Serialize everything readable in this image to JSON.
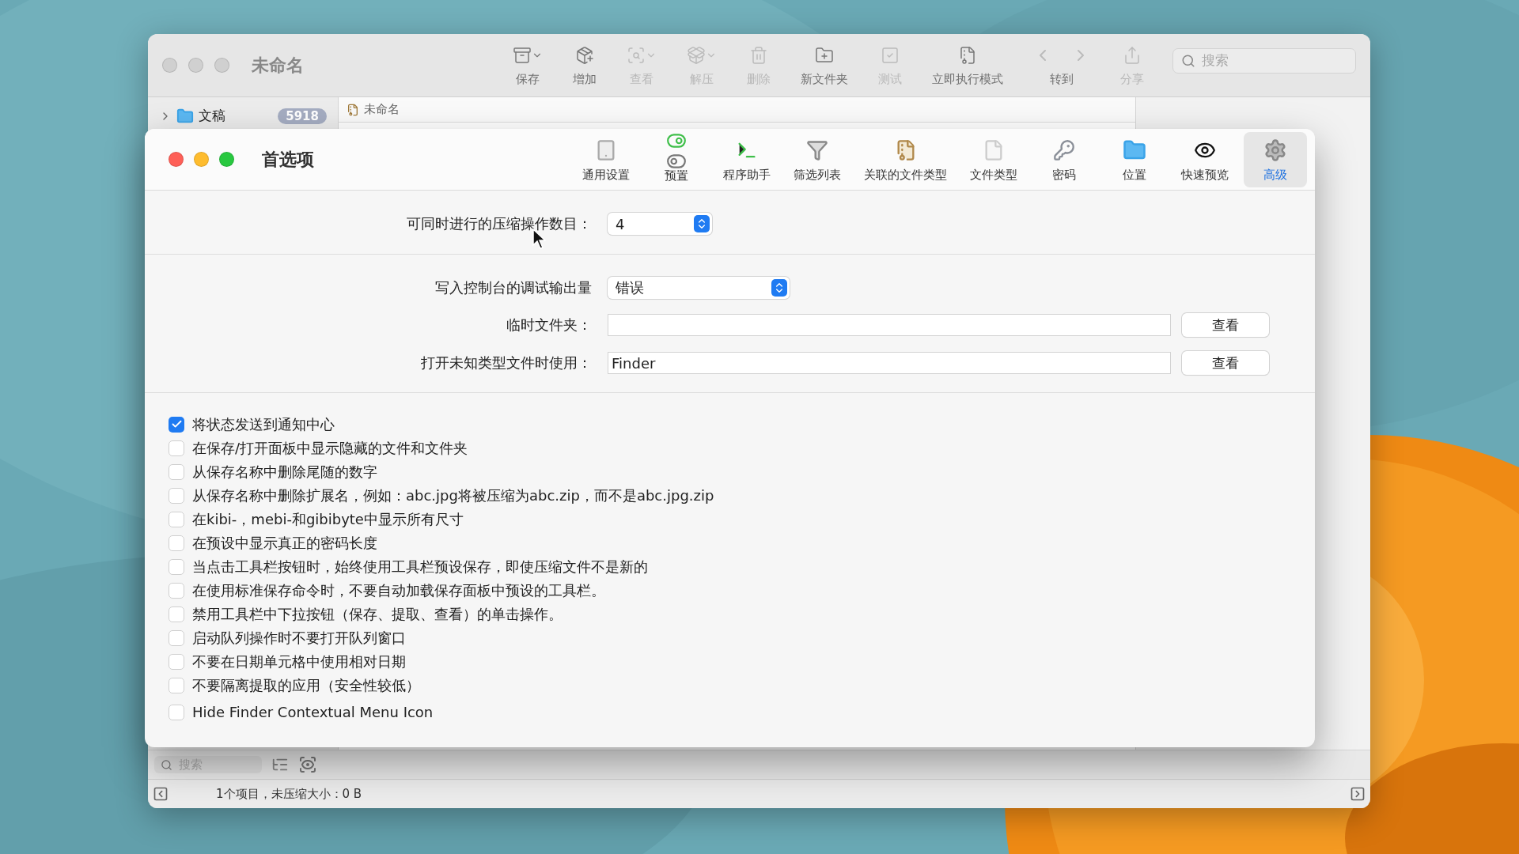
{
  "back_window": {
    "title": "未命名",
    "toolbar": [
      {
        "label": "保存",
        "disabled": false,
        "menu": true
      },
      {
        "label": "增加",
        "disabled": false,
        "menu": false
      },
      {
        "label": "查看",
        "disabled": true,
        "menu": true
      },
      {
        "label": "解压",
        "disabled": true,
        "menu": true
      },
      {
        "label": "删除",
        "disabled": true,
        "menu": false
      },
      {
        "label": "新文件夹",
        "disabled": false,
        "menu": false
      },
      {
        "label": "测试",
        "disabled": true,
        "menu": false
      },
      {
        "label": "立即执行模式",
        "disabled": false,
        "menu": false
      },
      {
        "label": "转到",
        "disabled": false,
        "menu": false
      },
      {
        "label": "分享",
        "disabled": true,
        "menu": false
      }
    ],
    "search": {
      "placeholder": "搜索"
    },
    "sidebar": {
      "items": [
        {
          "label": "文稿",
          "count": "5918",
          "expanded": false
        }
      ]
    },
    "column_header": "未命名",
    "bottom_search": {
      "placeholder": "搜索"
    },
    "status_bar": "1个项目，未压缩大小：0 B"
  },
  "preferences": {
    "title": "首选项",
    "tabs": [
      {
        "label": "通用设置",
        "selected": false
      },
      {
        "label": "预置",
        "selected": false
      },
      {
        "label": "程序助手",
        "selected": false
      },
      {
        "label": "筛选列表",
        "selected": false
      },
      {
        "label": "关联的文件类型",
        "selected": false
      },
      {
        "label": "文件类型",
        "selected": false
      },
      {
        "label": "密码",
        "selected": false
      },
      {
        "label": "位置",
        "selected": false
      },
      {
        "label": "快速预览",
        "selected": false
      },
      {
        "label": "高级",
        "selected": true
      }
    ],
    "concurrent": {
      "label": "可同时进行的压缩操作数目：",
      "value": "4"
    },
    "debug_output": {
      "label": "写入控制台的调试输出量",
      "value": "错误"
    },
    "fields": [
      {
        "label": "临时文件夹：",
        "button": "查看"
      },
      {
        "label": "打开未知类型文件时使用：",
        "value": "Finder",
        "button": "查看"
      }
    ],
    "options": [
      {
        "label": "将状态发送到通知中心",
        "checked": true
      },
      {
        "label": "在保存/打开面板中显示隐藏的文件和文件夹",
        "checked": false
      },
      {
        "label": "从保存名称中删除尾随的数字",
        "checked": false
      },
      {
        "label": "从保存名称中删除扩展名，例如：abc.jpg将被压缩为abc.zip，而不是abc.jpg.zip",
        "checked": false
      },
      {
        "label": "在kibi-，mebi-和gibibyte中显示所有尺寸",
        "checked": false
      },
      {
        "label": "在预设中显示真正的密码长度",
        "checked": false
      },
      {
        "label": "当点击工具栏按钮时，始终使用工具栏预设保存，即使压缩文件不是新的",
        "checked": false
      },
      {
        "label": "在使用标准保存命令时，不要自动加载保存面板中预设的工具栏。",
        "checked": false
      },
      {
        "label": "禁用工具栏中下拉按钮（保存、提取、查看）的单击操作。",
        "checked": false
      },
      {
        "label": "启动队列操作时不要打开队列窗口",
        "checked": false
      },
      {
        "label": "不要在日期单元格中使用相对日期",
        "checked": false
      },
      {
        "label": "不要隔离提取的应用（安全性较低）",
        "checked": false
      },
      {
        "label": "Hide Finder Contextual Menu Icon",
        "checked": false
      }
    ]
  }
}
